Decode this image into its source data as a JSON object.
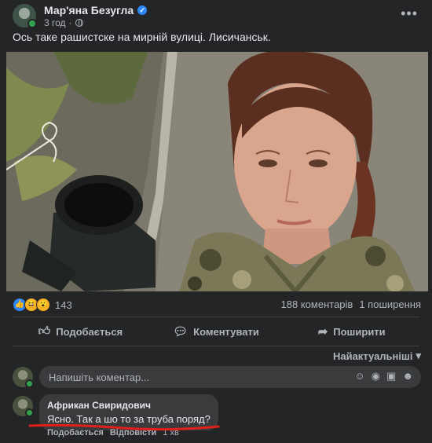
{
  "post": {
    "author": "Мар'яна Безугла",
    "time": "3 год",
    "caption": "Ось таке рашистске на мирній вулиці. Лисичанськ."
  },
  "icons": {
    "verified": "verified-badge-icon",
    "globe": "globe-icon",
    "more": "more-horizontal-icon",
    "like": "like-icon",
    "comment": "comment-icon",
    "share": "share-icon",
    "emoji": "emoji-icon",
    "camera": "camera-icon",
    "gif": "gif-icon",
    "sticker": "sticker-icon"
  },
  "stats": {
    "reaction_count": "143",
    "comments": "188 коментарів",
    "shares": "1 поширення"
  },
  "actions": {
    "like": "Подобається",
    "comment": "Коментувати",
    "share": "Поширити"
  },
  "sort": {
    "label": "Найактуальніші"
  },
  "composer": {
    "placeholder": "Напишіть коментар..."
  },
  "comment": {
    "author": "Африкан Свиридович",
    "text": "Ясно. Так а шо то за труба поряд?",
    "like": "Подобається",
    "reply": "Відповісти",
    "time": "1 хв"
  },
  "colors": {
    "background": "#242526",
    "bubble": "#3a3b3c",
    "accent": "#2d88ff",
    "annotation": "#e0201b"
  }
}
